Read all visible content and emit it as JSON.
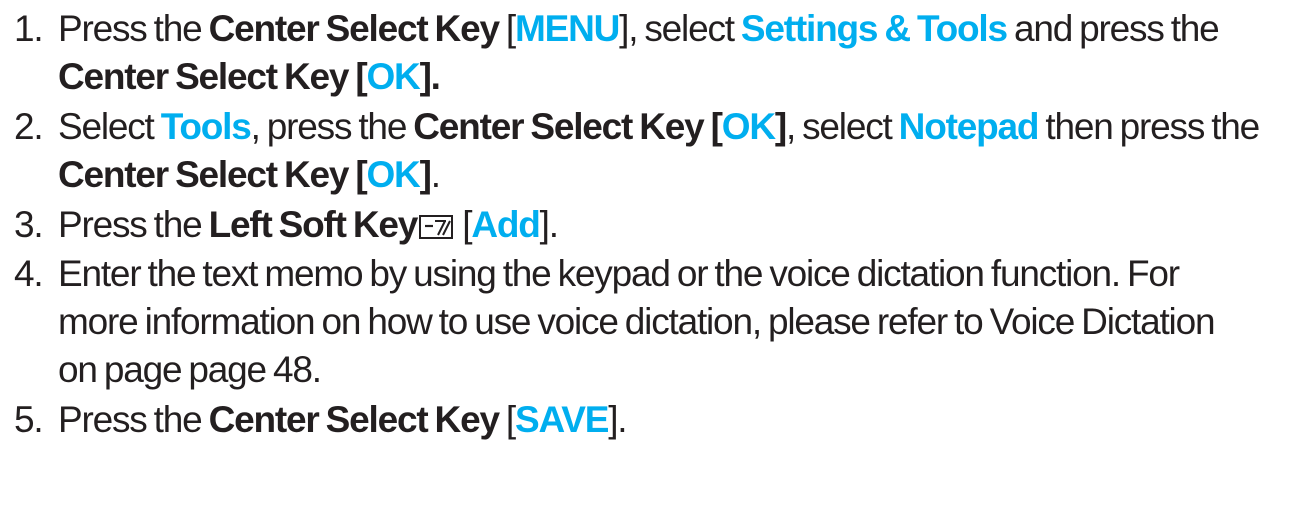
{
  "steps": [
    {
      "num": "1.",
      "line1": {
        "t1": "Press the ",
        "b1": "Center Select Key",
        "t2": " [",
        "h1": "MENU",
        "t3": "], select ",
        "h2": "Settings & Tools",
        "t4": " and press the"
      },
      "line2": {
        "b1": "Center Select Key",
        "t1": " [",
        "h1": "OK",
        "t2": "]."
      }
    },
    {
      "num": "2.",
      "line1": {
        "t1": "Select ",
        "h1": "Tools",
        "t2": ", press the ",
        "b1": "Center Select Key [",
        "h2": "OK",
        "b2": "]",
        "t3": ", select ",
        "h3": "Notepad",
        "t4": " then press the"
      },
      "line2": {
        "b1": "Center Select Key [",
        "h1": "OK",
        "b2": "]",
        "t1": "."
      }
    },
    {
      "num": "3.",
      "line1": {
        "t1": "Press the ",
        "b1": "Left Soft Key",
        "icon": "left-soft-key-icon",
        "t2": " [",
        "h1": "Add",
        "t3": "]."
      }
    },
    {
      "num": "4.",
      "line1": "Enter the text memo by using the keypad or the voice dictation function. For",
      "line2": "more information on how to use voice dictation, please refer to Voice Dictation",
      "line3": "on page page 48."
    },
    {
      "num": "5.",
      "line1": {
        "t1": "Press the ",
        "b1": "Center Select Key",
        "t2": " [",
        "h1": "SAVE",
        "t3": "]."
      }
    }
  ],
  "colors": {
    "text": "#231f20",
    "highlight": "#00aeef"
  }
}
